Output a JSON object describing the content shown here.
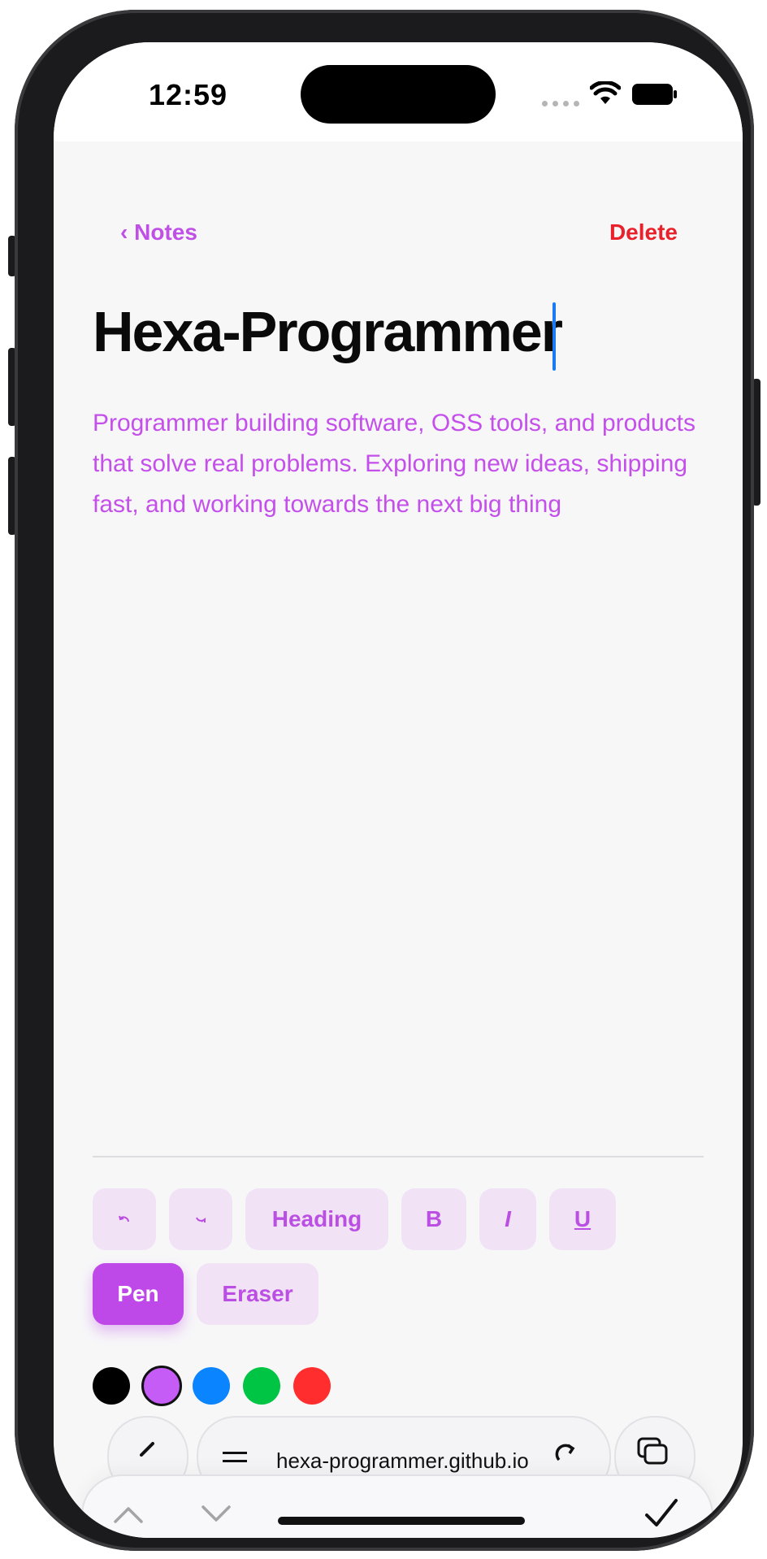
{
  "status_bar": {
    "time": "12:59"
  },
  "nav": {
    "back_label": "‹ Notes",
    "delete_label": "Delete"
  },
  "note": {
    "title": "Hexa-Programmer",
    "body": "Programmer building software, OSS tools, and products that solve real problems. Exploring new ideas, shipping fast, and working towards the next big thing"
  },
  "toolbar": {
    "undo_icon": "undo-icon",
    "redo_icon": "redo-icon",
    "heading_label": "Heading",
    "bold_label": "B",
    "italic_label": "I",
    "underline_label": "U",
    "pen_label": "Pen",
    "eraser_label": "Eraser"
  },
  "colors": {
    "accent": "#bf4fe6",
    "delete": "#e8212a",
    "swatches": [
      "#000000",
      "#c45cf5",
      "#0a84ff",
      "#00c443",
      "#ff2d2d"
    ],
    "selected_swatch": "#c45cf5"
  },
  "browser": {
    "url": "hexa-programmer.github.io"
  }
}
